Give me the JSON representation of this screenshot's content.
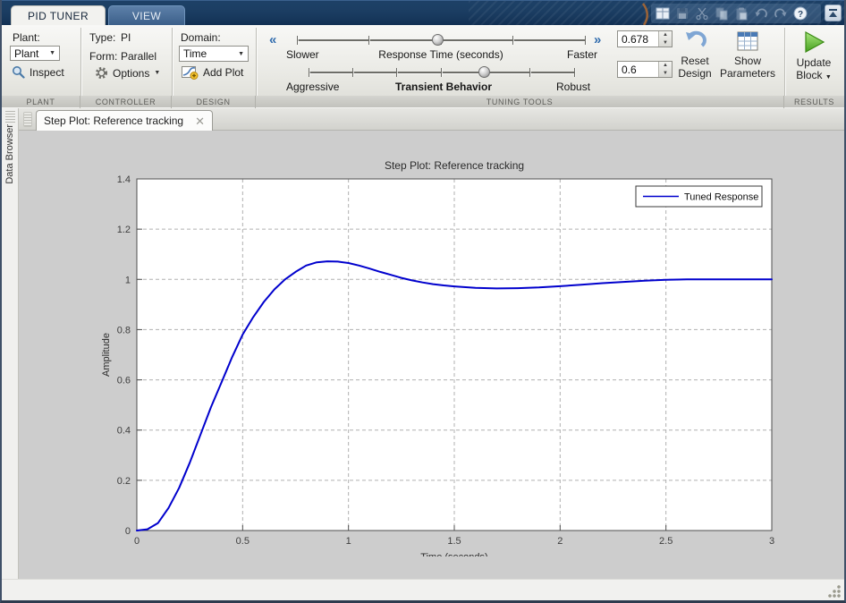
{
  "colors": {
    "header_bg": "#1b3d63",
    "accent_blue": "#2f6bad",
    "curve_blue": "#0000CD",
    "figure_bg": "#cdcdcd",
    "update_green": "#4ca521"
  },
  "header": {
    "tabs": [
      {
        "label": "PID TUNER",
        "active": true
      },
      {
        "label": "VIEW",
        "active": false
      }
    ],
    "quick_access_icons": [
      "layout-grid-icon",
      "save-icon",
      "cut-icon",
      "copy-icon",
      "paste-icon",
      "undo-icon",
      "redo-icon",
      "help-icon",
      "minimize-toolstrip-icon"
    ]
  },
  "toolstrip": {
    "plant": {
      "section_label": "PLANT",
      "field_label": "Plant:",
      "dropdown_value": "Plant",
      "inspect_label": "Inspect"
    },
    "controller": {
      "section_label": "CONTROLLER",
      "type_label": "Type:",
      "type_value": "PI",
      "form_label": "Form:",
      "form_value": "Parallel",
      "options_label": "Options"
    },
    "design": {
      "section_label": "DESIGN",
      "domain_label": "Domain:",
      "domain_value": "Time",
      "add_plot_label": "Add Plot"
    },
    "tuning_tools": {
      "section_label": "TUNING TOOLS",
      "response_slider": {
        "left_label": "Slower",
        "title": "Response Time (seconds)",
        "right_label": "Faster",
        "fraction": 0.49,
        "tick_count": 5
      },
      "transient_slider": {
        "left_label": "Aggressive",
        "title": "Transient Behavior",
        "right_label": "Robust",
        "fraction": 0.663,
        "tick_count": 7
      },
      "response_time_value": "0.678",
      "transient_behavior_value": "0.6",
      "reset_design_label": "Reset Design",
      "show_parameters_label": "Show Parameters"
    },
    "results": {
      "section_label": "RESULTS",
      "update_block_label": "Update Block"
    }
  },
  "side_panel": {
    "label": "Data Browser"
  },
  "document": {
    "tab_label": "Step Plot: Reference tracking"
  },
  "chart_data": {
    "type": "line",
    "title": "Step Plot: Reference tracking",
    "xlabel": "Time (seconds)",
    "ylabel": "Amplitude",
    "xlim": [
      0,
      3
    ],
    "ylim": [
      0,
      1.4
    ],
    "xticks": [
      0,
      0.5,
      1,
      1.5,
      2,
      2.5,
      3
    ],
    "xtick_labels": [
      "0",
      "0.5",
      "1",
      "1.5",
      "2",
      "2.5",
      "3"
    ],
    "yticks": [
      0,
      0.2,
      0.4,
      0.6,
      0.8,
      1,
      1.2,
      1.4
    ],
    "ytick_labels": [
      "0",
      "0.2",
      "0.4",
      "0.6",
      "0.8",
      "1",
      "1.2",
      "1.4"
    ],
    "grid": true,
    "legend": {
      "position": "top-right",
      "entries": [
        {
          "label": "Tuned Response",
          "color": "#0000CD"
        }
      ]
    },
    "series": [
      {
        "name": "Tuned Response",
        "color": "#0000CD",
        "x": [
          0,
          0.05,
          0.1,
          0.15,
          0.2,
          0.25,
          0.3,
          0.35,
          0.4,
          0.45,
          0.5,
          0.55,
          0.6,
          0.65,
          0.7,
          0.75,
          0.8,
          0.85,
          0.9,
          0.95,
          1.0,
          1.05,
          1.1,
          1.15,
          1.2,
          1.25,
          1.3,
          1.35,
          1.4,
          1.45,
          1.5,
          1.6,
          1.7,
          1.8,
          1.9,
          2.0,
          2.1,
          2.2,
          2.3,
          2.4,
          2.5,
          2.6,
          2.7,
          2.8,
          2.9,
          3.0
        ],
        "y": [
          0,
          0.005,
          0.03,
          0.09,
          0.17,
          0.27,
          0.38,
          0.49,
          0.59,
          0.69,
          0.78,
          0.85,
          0.91,
          0.96,
          1.0,
          1.03,
          1.055,
          1.068,
          1.072,
          1.071,
          1.065,
          1.055,
          1.043,
          1.03,
          1.018,
          1.006,
          0.996,
          0.988,
          0.981,
          0.976,
          0.972,
          0.966,
          0.964,
          0.965,
          0.968,
          0.973,
          0.979,
          0.985,
          0.99,
          0.995,
          0.998,
          1.0,
          1.0,
          1.0,
          1.0,
          1.0
        ]
      }
    ]
  }
}
